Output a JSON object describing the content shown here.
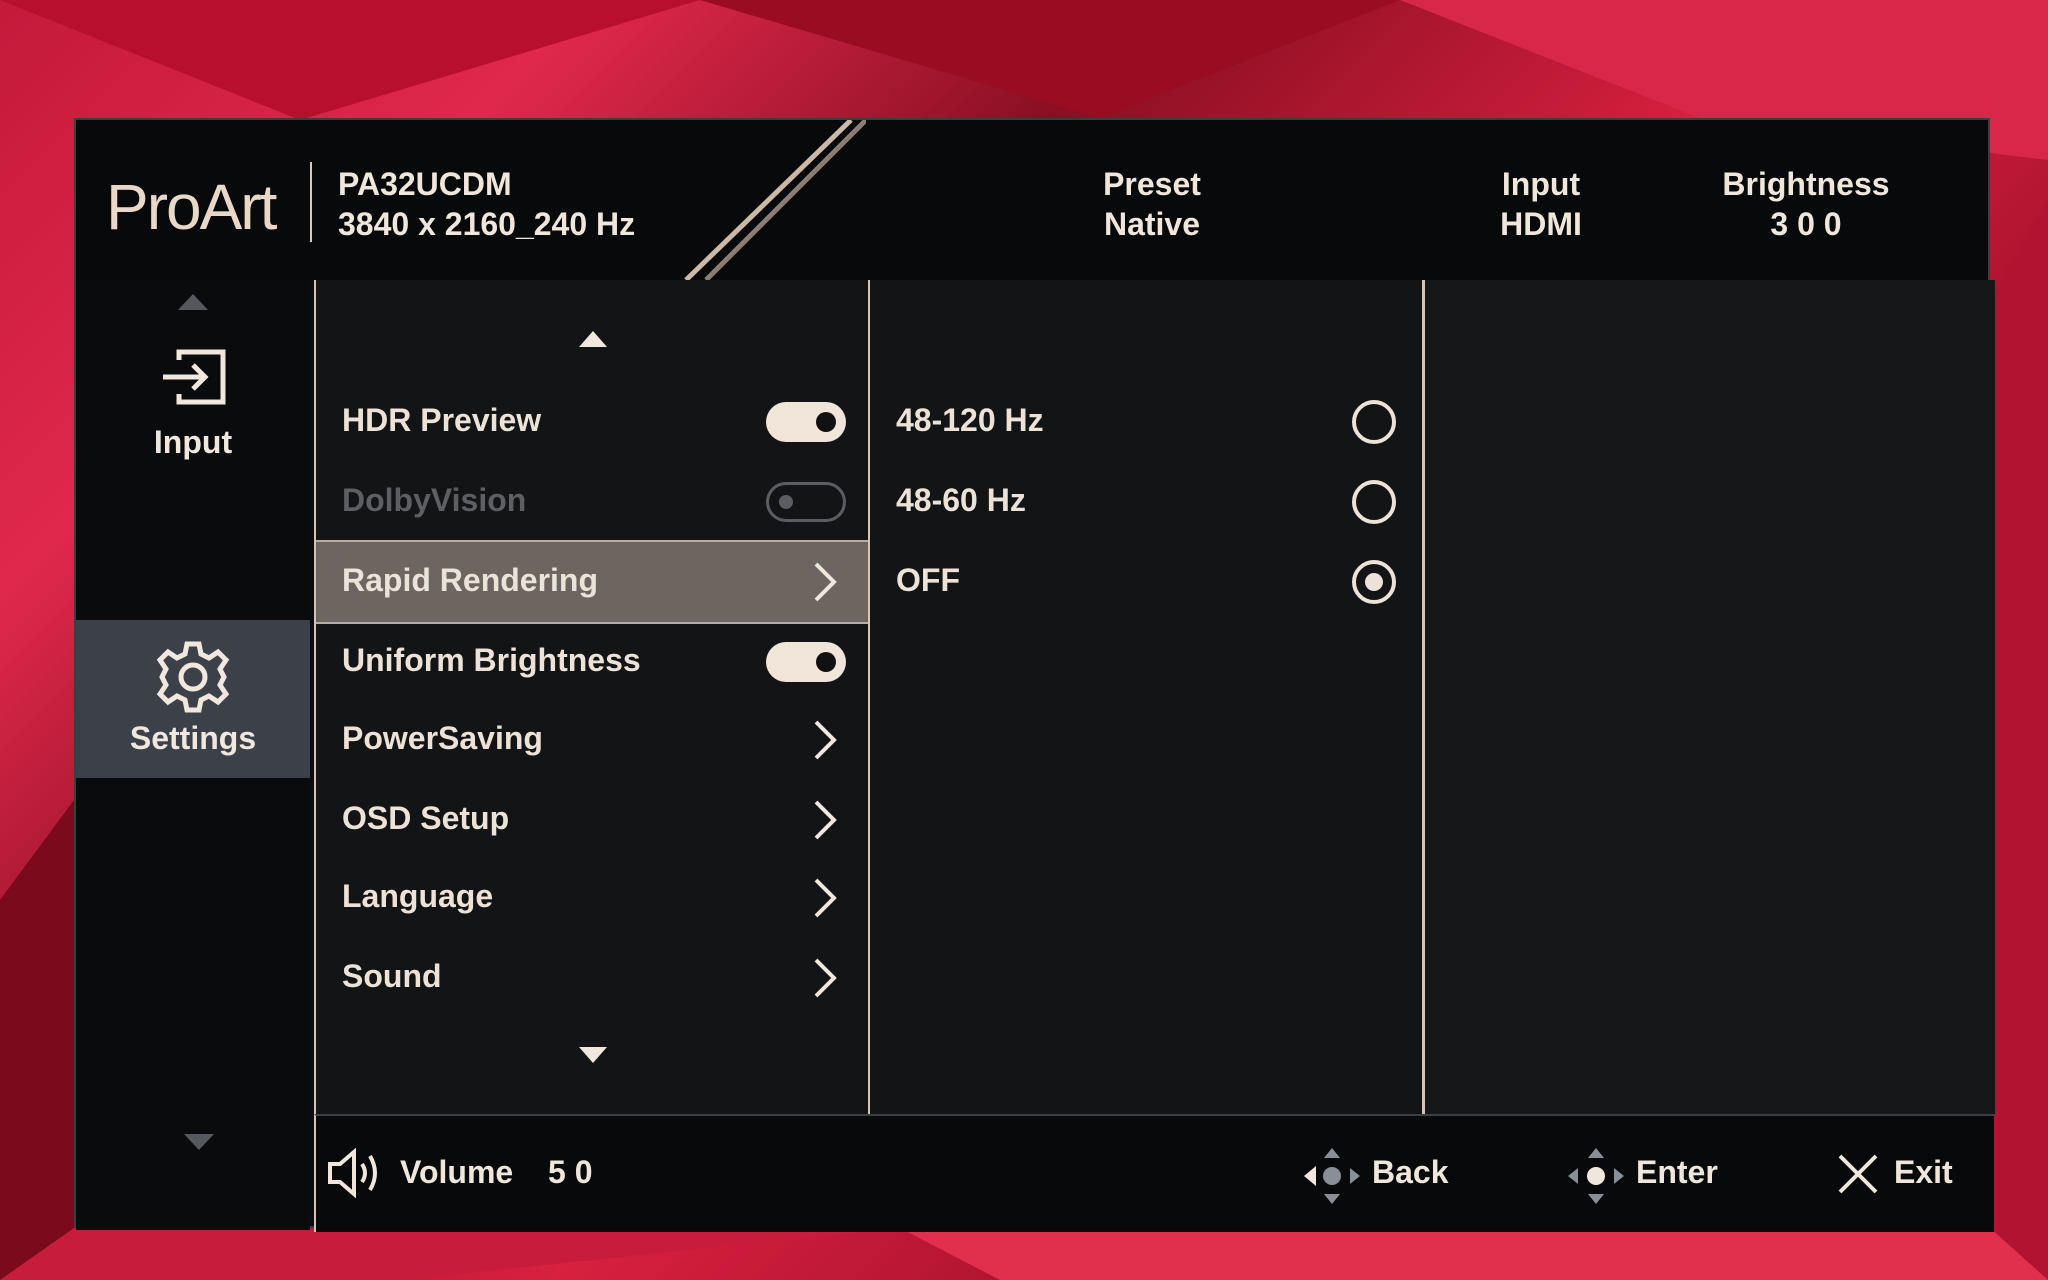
{
  "header": {
    "logo": "ProArt",
    "model": "PA32UCDM",
    "resolution": "3840 x 2160_240 Hz",
    "preset_label": "Preset",
    "preset_value": "Native",
    "input_label": "Input",
    "input_value": "HDMI",
    "brightness_label": "Brightness",
    "brightness_value": "3 0 0"
  },
  "nav": {
    "items": [
      {
        "label": "Input",
        "icon": "input-icon"
      },
      {
        "label": "Settings",
        "icon": "gear-icon",
        "active": true
      }
    ]
  },
  "settings": {
    "items": [
      {
        "label": "HDR Preview",
        "control": "toggle-on"
      },
      {
        "label": "DolbyVision",
        "control": "toggle-off",
        "disabled": true
      },
      {
        "label": "Rapid Rendering",
        "control": "chevron",
        "active": true
      },
      {
        "label": "Uniform Brightness",
        "control": "toggle-on"
      },
      {
        "label": "PowerSaving",
        "control": "chevron"
      },
      {
        "label": "OSD Setup",
        "control": "chevron"
      },
      {
        "label": "Language",
        "control": "chevron"
      },
      {
        "label": "Sound",
        "control": "chevron"
      }
    ]
  },
  "options": {
    "items": [
      {
        "label": "48-120 Hz",
        "selected": false
      },
      {
        "label": "48-60 Hz",
        "selected": false
      },
      {
        "label": "OFF",
        "selected": true
      }
    ]
  },
  "footer": {
    "volume_label": "Volume",
    "volume_value": "5 0",
    "back_label": "Back",
    "enter_label": "Enter",
    "exit_label": "Exit"
  },
  "colors": {
    "accent": "#ece2d8",
    "panel": "#131416",
    "active_row": "#6d6560",
    "active_nav": "#3c4149"
  }
}
